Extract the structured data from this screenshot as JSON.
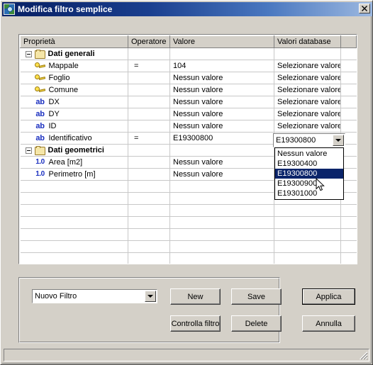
{
  "window": {
    "title": "Modifica filtro semplice",
    "app_icon": "map-globe-icon",
    "close_label": "✕"
  },
  "grid": {
    "columns": [
      "Proprietà",
      "Operatore",
      "Valore",
      "Valori database",
      ""
    ],
    "rows": [
      {
        "type": "group",
        "icon": "folder-icon",
        "property": "Dati generali",
        "operator": "",
        "value": "",
        "db_value": ""
      },
      {
        "type": "item",
        "icon": "key-icon",
        "property": "Mappale",
        "operator": "=",
        "value": "104",
        "db_value": "Selezionare valore"
      },
      {
        "type": "item",
        "icon": "key-icon",
        "property": "Foglio",
        "operator": "",
        "value": "Nessun valore",
        "db_value": "Selezionare valore"
      },
      {
        "type": "item",
        "icon": "key-icon",
        "property": "Comune",
        "operator": "",
        "value": "Nessun valore",
        "db_value": "Selezionare valore"
      },
      {
        "type": "item",
        "icon": "ab-icon",
        "property": "DX",
        "operator": "",
        "value": "Nessun valore",
        "db_value": "Selezionare valore"
      },
      {
        "type": "item",
        "icon": "ab-icon",
        "property": "DY",
        "operator": "",
        "value": "Nessun valore",
        "db_value": "Selezionare valore"
      },
      {
        "type": "item",
        "icon": "ab-icon",
        "property": "ID",
        "operator": "",
        "value": "Nessun valore",
        "db_value": "Selezionare valore"
      },
      {
        "type": "item",
        "icon": "ab-icon",
        "property": "Identificativo",
        "operator": "=",
        "value": "E19300800",
        "db_value": ""
      },
      {
        "type": "group",
        "icon": "folder-icon",
        "property": "Dati geometrici",
        "operator": "",
        "value": "",
        "db_value": ""
      },
      {
        "type": "item",
        "icon": "number-icon",
        "property": "Area [m2]",
        "operator": "",
        "value": "Nessun valore",
        "db_value": ""
      },
      {
        "type": "item",
        "icon": "number-icon",
        "property": "Perimetro [m]",
        "operator": "",
        "value": "Nessun valore",
        "db_value": ""
      }
    ],
    "empty_row_count": 8,
    "icon_glyphs": {
      "ab-icon": "ab",
      "number-icon": "1.0"
    },
    "expander_glyph": "−"
  },
  "db_combo": {
    "value": "E19300800",
    "arrow_icon": "chevron-down-icon",
    "options": [
      {
        "label": "Nessun valore",
        "selected": false
      },
      {
        "label": "E19300400",
        "selected": false
      },
      {
        "label": "E19300800",
        "selected": true
      },
      {
        "label": "E19300900",
        "selected": false
      },
      {
        "label": "E19301000",
        "selected": false
      }
    ]
  },
  "bottom": {
    "filter_combo": {
      "value": "Nuovo Filtro",
      "arrow_icon": "chevron-down-icon"
    },
    "buttons": {
      "new": "New",
      "save": "Save",
      "controlla": "Controlla filtro",
      "delete": "Delete",
      "applica": "Applica",
      "annulla": "Annulla"
    }
  },
  "statusbar": {
    "text": "",
    "grip_icon": "resize-grip-icon"
  },
  "colors": {
    "face": "#d4d0c8",
    "title_active": "#0a246a",
    "selection": "#0a246a",
    "grid_line": "#c8c8c8",
    "icon_blue": "#1a2fc0",
    "key_yellow": "#ffe14d",
    "folder_yellow": "#f5e6a8"
  }
}
